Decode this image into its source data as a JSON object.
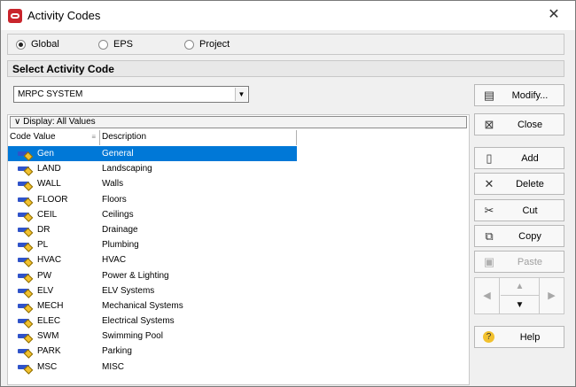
{
  "window": {
    "title": "Activity Codes"
  },
  "scope": {
    "options": [
      {
        "label": "Global",
        "selected": true
      },
      {
        "label": "EPS",
        "selected": false
      },
      {
        "label": "Project",
        "selected": false
      }
    ]
  },
  "section": {
    "title": "Select Activity Code"
  },
  "code_select": {
    "value": "MRPC SYSTEM"
  },
  "filter": {
    "label": "Display: All Values"
  },
  "table": {
    "headers": {
      "code": "Code Value",
      "desc": "Description"
    },
    "rows": [
      {
        "code": "Gen",
        "desc": "General",
        "selected": true
      },
      {
        "code": "LAND",
        "desc": "Landscaping"
      },
      {
        "code": "WALL",
        "desc": "Walls"
      },
      {
        "code": "FLOOR",
        "desc": "Floors"
      },
      {
        "code": "CEIL",
        "desc": "Ceilings"
      },
      {
        "code": "DR",
        "desc": "Drainage"
      },
      {
        "code": "PL",
        "desc": "Plumbing"
      },
      {
        "code": "HVAC",
        "desc": "HVAC"
      },
      {
        "code": "PW",
        "desc": "Power & Lighting"
      },
      {
        "code": "ELV",
        "desc": "ELV Systems"
      },
      {
        "code": "MECH",
        "desc": "Mechanical Systems"
      },
      {
        "code": "ELEC",
        "desc": "Electrical Systems"
      },
      {
        "code": "SWM",
        "desc": "Swimming Pool"
      },
      {
        "code": "PARK",
        "desc": "Parking"
      },
      {
        "code": "MSC",
        "desc": "MISC"
      }
    ]
  },
  "buttons": {
    "modify": "Modify...",
    "close": "Close",
    "add": "Add",
    "delete": "Delete",
    "cut": "Cut",
    "copy": "Copy",
    "paste": "Paste",
    "help": "Help"
  },
  "colors": {
    "selection": "#0078d7",
    "brand": "#c9252c"
  }
}
